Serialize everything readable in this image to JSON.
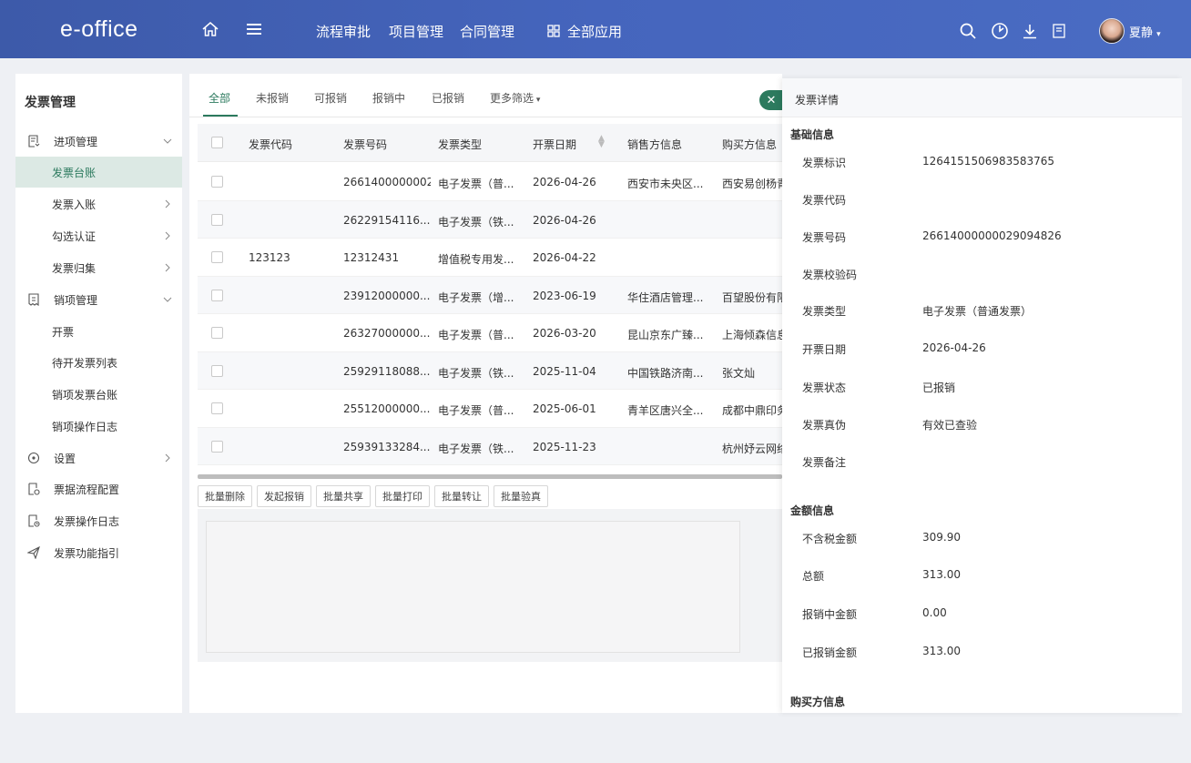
{
  "header": {
    "logo": "e-office",
    "nav": [
      "流程审批",
      "项目管理",
      "合同管理"
    ],
    "all_apps": "全部应用",
    "username": "夏静"
  },
  "sidebar": {
    "title": "发票管理",
    "items": [
      {
        "label": "进项管理",
        "icon": "inbound-invoice-icon",
        "type": "group"
      },
      {
        "label": "发票台账",
        "type": "sub",
        "active": true
      },
      {
        "label": "发票入账",
        "type": "sub"
      },
      {
        "label": "勾选认证",
        "type": "sub"
      },
      {
        "label": "发票归集",
        "type": "sub"
      },
      {
        "label": "销项管理",
        "icon": "outbound-invoice-icon",
        "type": "group"
      },
      {
        "label": "开票",
        "type": "sub"
      },
      {
        "label": "待开发票列表",
        "type": "sub"
      },
      {
        "label": "销项发票台账",
        "type": "sub"
      },
      {
        "label": "销项操作日志",
        "type": "sub"
      },
      {
        "label": "设置",
        "icon": "settings-icon",
        "type": "group"
      },
      {
        "label": "票据流程配置",
        "icon": "flow-config-icon",
        "type": "group"
      },
      {
        "label": "发票操作日志",
        "icon": "log-icon",
        "type": "group"
      },
      {
        "label": "发票功能指引",
        "icon": "guide-icon",
        "type": "group"
      }
    ]
  },
  "tabs": [
    "全部",
    "未报销",
    "可报销",
    "报销中",
    "已报销",
    "更多筛选"
  ],
  "table": {
    "columns": [
      "发票代码",
      "发票号码",
      "发票类型",
      "开票日期",
      "销售方信息",
      "购买方信息"
    ],
    "rows": [
      {
        "code": "",
        "number": "2661400000002",
        "type": "电子发票（普...",
        "date": "2026-04-26",
        "seller": "西安市未央区...",
        "buyer": "西安易创杨青"
      },
      {
        "code": "",
        "number": "26229154116...",
        "type": "电子发票（铁...",
        "date": "2026-04-26",
        "seller": "",
        "buyer": ""
      },
      {
        "code": "123123",
        "number": "12312431",
        "type": "增值税专用发...",
        "date": "2026-04-22",
        "seller": "",
        "buyer": ""
      },
      {
        "code": "",
        "number": "23912000000...",
        "type": "电子发票（增...",
        "date": "2023-06-19",
        "seller": "华住酒店管理...",
        "buyer": "百望股份有限"
      },
      {
        "code": "",
        "number": "26327000000...",
        "type": "电子发票（普...",
        "date": "2026-03-20",
        "seller": "昆山京东广臻...",
        "buyer": "上海倾森信息"
      },
      {
        "code": "",
        "number": "25929118088...",
        "type": "电子发票（铁...",
        "date": "2025-11-04",
        "seller": "中国铁路济南...",
        "buyer": "张文灿"
      },
      {
        "code": "",
        "number": "25512000000...",
        "type": "电子发票（普...",
        "date": "2025-06-01",
        "seller": "青羊区唐兴全...",
        "buyer": "成都中鼎印务"
      },
      {
        "code": "",
        "number": "25939133284...",
        "type": "电子发票（铁...",
        "date": "2025-11-23",
        "seller": "",
        "buyer": "杭州妤云网络"
      }
    ]
  },
  "batch_buttons": [
    "批量删除",
    "发起报销",
    "批量共享",
    "批量打印",
    "批量转让",
    "批量验真"
  ],
  "detail": {
    "title": "发票详情",
    "basic_title": "基础信息",
    "basic": [
      {
        "label": "发票标识",
        "value": "1264151506983583765"
      },
      {
        "label": "发票代码",
        "value": ""
      },
      {
        "label": "发票号码",
        "value": "26614000000029094826"
      },
      {
        "label": "发票校验码",
        "value": ""
      },
      {
        "label": "发票类型",
        "value": "电子发票（普通发票）"
      },
      {
        "label": "开票日期",
        "value": "2026-04-26"
      },
      {
        "label": "发票状态",
        "value": "已报销"
      },
      {
        "label": "发票真伪",
        "value": "有效已查验"
      },
      {
        "label": "发票备注",
        "value": ""
      }
    ],
    "amount_title": "金额信息",
    "amount": [
      {
        "label": "不含税金额",
        "value": "309.90"
      },
      {
        "label": "总额",
        "value": "313.00"
      },
      {
        "label": "报销中金额",
        "value": "0.00"
      },
      {
        "label": "已报销金额",
        "value": "313.00"
      }
    ],
    "buyer_title": "购买方信息"
  },
  "colors": {
    "topbar": "#4565bd",
    "accent": "#2c7a5e",
    "active_bg": "#dce9e4"
  }
}
